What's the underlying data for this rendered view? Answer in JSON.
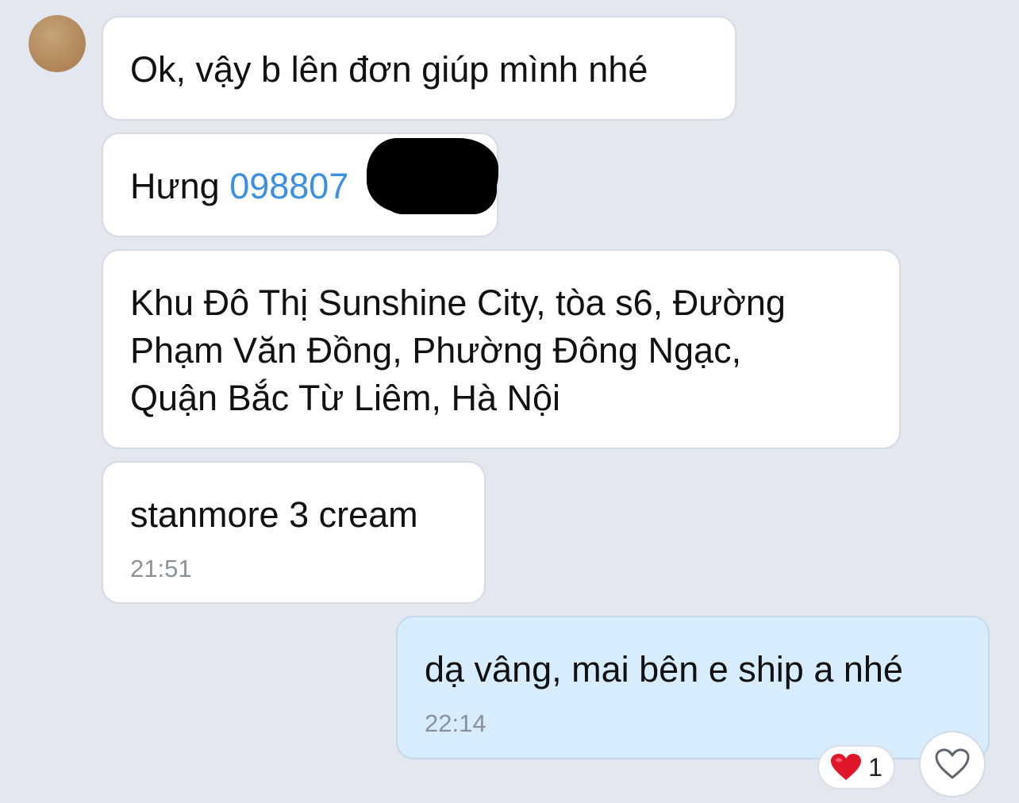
{
  "messages": [
    {
      "text": "Ok, vậy b lên đơn giúp mình nhé"
    },
    {
      "name": "Hưng",
      "phone": "098807"
    },
    {
      "lines": [
        "Khu Đô Thị Sunshine City, tòa s6, Đường",
        "Phạm Văn Đồng, Phường Đông Ngạc,",
        "Quận Bắc Từ Liêm, Hà Nội"
      ]
    },
    {
      "text": "stanmore 3 cream",
      "time": "21:51"
    },
    {
      "text": "dạ vâng, mai bên e ship a nhé",
      "time": "22:14"
    }
  ],
  "reaction": {
    "icon": "heart-icon",
    "count": "1",
    "color": "#e0162b"
  },
  "like_button": {
    "icon": "heart-outline-icon"
  },
  "colors": {
    "background": "#e3e7ef",
    "incoming_bubble": "#ffffff",
    "outgoing_bubble": "#d7ecfc",
    "link": "#3d8fe0"
  }
}
